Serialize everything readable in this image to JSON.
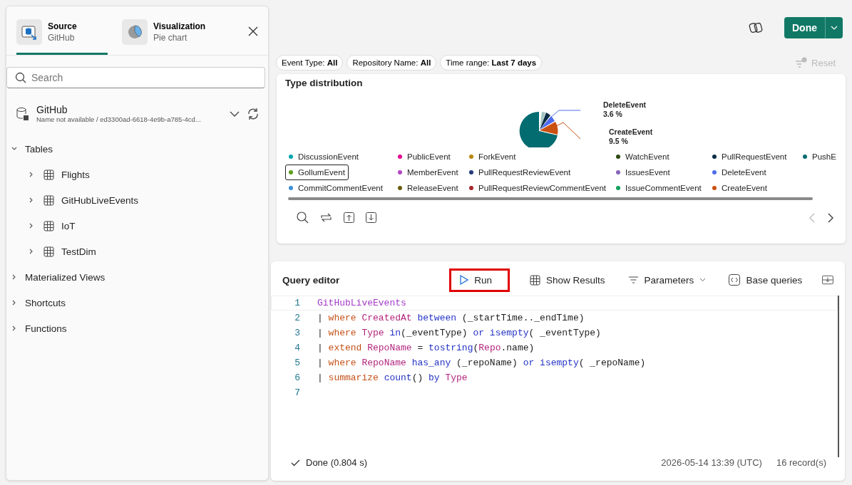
{
  "panel_tabs": [
    {
      "label": "Source",
      "sublabel": "GitHub",
      "kind": "source",
      "selected": true
    },
    {
      "label": "Visualization",
      "sublabel": "Pie chart",
      "kind": "pie",
      "selected": false
    }
  ],
  "search": {
    "placeholder": "Search"
  },
  "database": {
    "name": "GitHub",
    "path": "Name not available / ed3300ad-6618-4e9b-a785-4cd..."
  },
  "tree": [
    {
      "label": "Tables",
      "expanded": true,
      "children": [
        {
          "label": "Flights",
          "expanded": false
        },
        {
          "label": "GitHubLiveEvents",
          "expanded": false
        },
        {
          "label": "IoT",
          "expanded": false
        },
        {
          "label": "TestDim",
          "expanded": false
        }
      ]
    },
    {
      "label": "Materialized Views",
      "expanded": false
    },
    {
      "label": "Shortcuts",
      "expanded": false
    },
    {
      "label": "Functions",
      "expanded": false
    }
  ],
  "done_button": {
    "label": "Done"
  },
  "filters": [
    {
      "name": "Event Type:",
      "value": "All"
    },
    {
      "name": "Repository Name:",
      "value": "All"
    },
    {
      "name": "Time range:",
      "value": "Last 7 days"
    }
  ],
  "reset_button": {
    "label": "Reset",
    "disabled": true
  },
  "chart_card": {
    "title": "Type distribution",
    "callouts": [
      {
        "label": "DeleteEvent",
        "value": "3.6 %"
      },
      {
        "label": "CreateEvent",
        "value": "9.5 %"
      }
    ],
    "legend": [
      [
        {
          "label": "DiscussionEvent",
          "color": "#00a5b0",
          "selected": false
        },
        {
          "label": "GollumEvent",
          "color": "#5c9e1e",
          "selected": true
        },
        {
          "label": "CommitCommentEvent",
          "color": "#3a8fd6",
          "selected": false
        }
      ],
      [
        {
          "label": "PublicEvent",
          "color": "#e3008c",
          "selected": false
        },
        {
          "label": "MemberEvent",
          "color": "#b146c2",
          "selected": false
        },
        {
          "label": "ReleaseEvent",
          "color": "#6b5c0a",
          "selected": false
        }
      ],
      [
        {
          "label": "ForkEvent",
          "color": "#b8860b",
          "selected": false
        },
        {
          "label": "PullRequestReviewEvent",
          "color": "#243a7a",
          "selected": false
        },
        {
          "label": "PullRequestReviewCommentEvent",
          "color": "#a4262c",
          "selected": false
        }
      ],
      [
        {
          "label": "WatchEvent",
          "color": "#2d4a12",
          "selected": false
        },
        {
          "label": "IssuesEvent",
          "color": "#8764b8",
          "selected": false
        },
        {
          "label": "IssueCommentEvent",
          "color": "#13a05a",
          "selected": false
        }
      ],
      [
        {
          "label": "PullRequestEvent",
          "color": "#0b2e45",
          "selected": false
        },
        {
          "label": "DeleteEvent",
          "color": "#4f6bed",
          "selected": false
        },
        {
          "label": "CreateEvent",
          "color": "#ca5010",
          "selected": false
        }
      ],
      [
        {
          "label": "PushE",
          "color": "#036c70",
          "selected": false
        }
      ]
    ]
  },
  "query_editor": {
    "title": "Query editor",
    "toolbar": [
      {
        "label": "Run",
        "kind": "run",
        "highlighted": true
      },
      {
        "label": "Show Results",
        "kind": "table",
        "highlighted": false
      },
      {
        "label": "Parameters",
        "kind": "filter",
        "highlighted": false
      },
      {
        "label": "Base queries",
        "kind": "code",
        "highlighted": false
      }
    ],
    "lines": [
      {
        "number": "1",
        "tokens": [
          {
            "text": "GitHubLiveEvents",
            "kind": "table"
          }
        ]
      },
      {
        "number": "2",
        "tokens": [
          {
            "text": "| ",
            "kind": "plain"
          },
          {
            "text": "where ",
            "kind": "keyword"
          },
          {
            "text": "CreatedAt ",
            "kind": "column"
          },
          {
            "text": "between ",
            "kind": "function"
          },
          {
            "text": "(_startTime.._endTime)",
            "kind": "plain"
          }
        ]
      },
      {
        "number": "3",
        "tokens": [
          {
            "text": "| ",
            "kind": "plain"
          },
          {
            "text": "where ",
            "kind": "keyword"
          },
          {
            "text": "Type ",
            "kind": "column"
          },
          {
            "text": "in",
            "kind": "function"
          },
          {
            "text": "(_eventType) ",
            "kind": "plain"
          },
          {
            "text": "or isempty",
            "kind": "function"
          },
          {
            "text": "( _eventType)",
            "kind": "plain"
          }
        ]
      },
      {
        "number": "4",
        "tokens": [
          {
            "text": "| ",
            "kind": "plain"
          },
          {
            "text": "extend ",
            "kind": "keyword"
          },
          {
            "text": "RepoName ",
            "kind": "column"
          },
          {
            "text": "= ",
            "kind": "plain"
          },
          {
            "text": "tostring",
            "kind": "function"
          },
          {
            "text": "(",
            "kind": "plain"
          },
          {
            "text": "Repo",
            "kind": "column"
          },
          {
            "text": ".name)",
            "kind": "plain"
          }
        ]
      },
      {
        "number": "5",
        "tokens": [
          {
            "text": "| ",
            "kind": "plain"
          },
          {
            "text": "where ",
            "kind": "keyword"
          },
          {
            "text": "RepoName ",
            "kind": "column"
          },
          {
            "text": "has_any ",
            "kind": "function"
          },
          {
            "text": "(_repoName) ",
            "kind": "plain"
          },
          {
            "text": "or isempty",
            "kind": "function"
          },
          {
            "text": "( _repoName)",
            "kind": "plain"
          }
        ]
      },
      {
        "number": "6",
        "tokens": [
          {
            "text": "| ",
            "kind": "plain"
          },
          {
            "text": "summarize ",
            "kind": "keyword"
          },
          {
            "text": "count",
            "kind": "function"
          },
          {
            "text": "() ",
            "kind": "plain"
          },
          {
            "text": "by ",
            "kind": "function"
          },
          {
            "text": "Type",
            "kind": "column"
          }
        ]
      },
      {
        "number": "7"
      }
    ],
    "status": "Done (0.804 s)",
    "timestamp": "2026-05-14 13:39 (UTC)",
    "records": "16 record(s)"
  }
}
